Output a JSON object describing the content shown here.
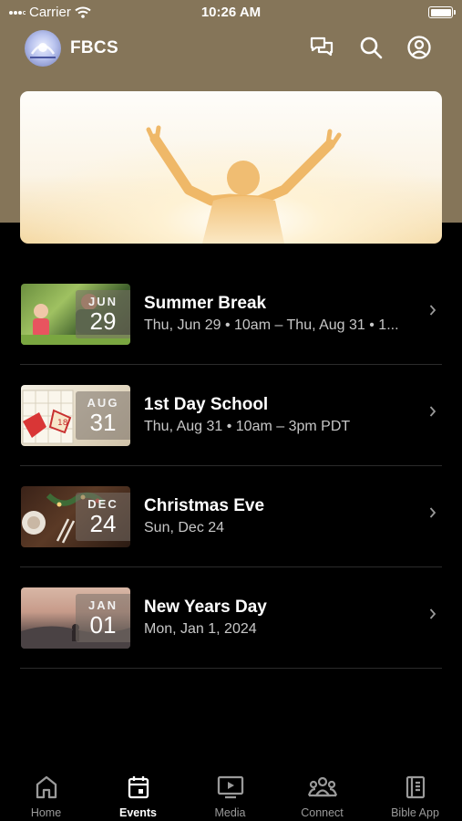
{
  "status_bar": {
    "carrier": "Carrier",
    "time": "10:26 AM"
  },
  "header": {
    "title": "FBCS",
    "icons": [
      "chat-icon",
      "search-icon",
      "profile-icon"
    ]
  },
  "colors": {
    "header_band": "#857559",
    "background": "#000000",
    "accent": "#ffffff",
    "muted": "#9a9a9a"
  },
  "events": [
    {
      "month": "JUN",
      "day": "29",
      "title": "Summer Break",
      "subtitle": "Thu, Jun 29 • 10am – Thu, Aug 31 • 1..."
    },
    {
      "month": "AUG",
      "day": "31",
      "title": "1st Day School",
      "subtitle": "Thu, Aug 31 • 10am – 3pm PDT"
    },
    {
      "month": "DEC",
      "day": "24",
      "title": "Christmas Eve",
      "subtitle": "Sun, Dec 24"
    },
    {
      "month": "JAN",
      "day": "01",
      "title": "New Years Day",
      "subtitle": "Mon, Jan 1, 2024"
    }
  ],
  "tabs": [
    {
      "label": "Home",
      "icon": "home-icon",
      "active": false
    },
    {
      "label": "Events",
      "icon": "calendar-icon",
      "active": true
    },
    {
      "label": "Media",
      "icon": "media-icon",
      "active": false
    },
    {
      "label": "Connect",
      "icon": "people-icon",
      "active": false
    },
    {
      "label": "Bible App",
      "icon": "bible-icon",
      "active": false
    }
  ]
}
